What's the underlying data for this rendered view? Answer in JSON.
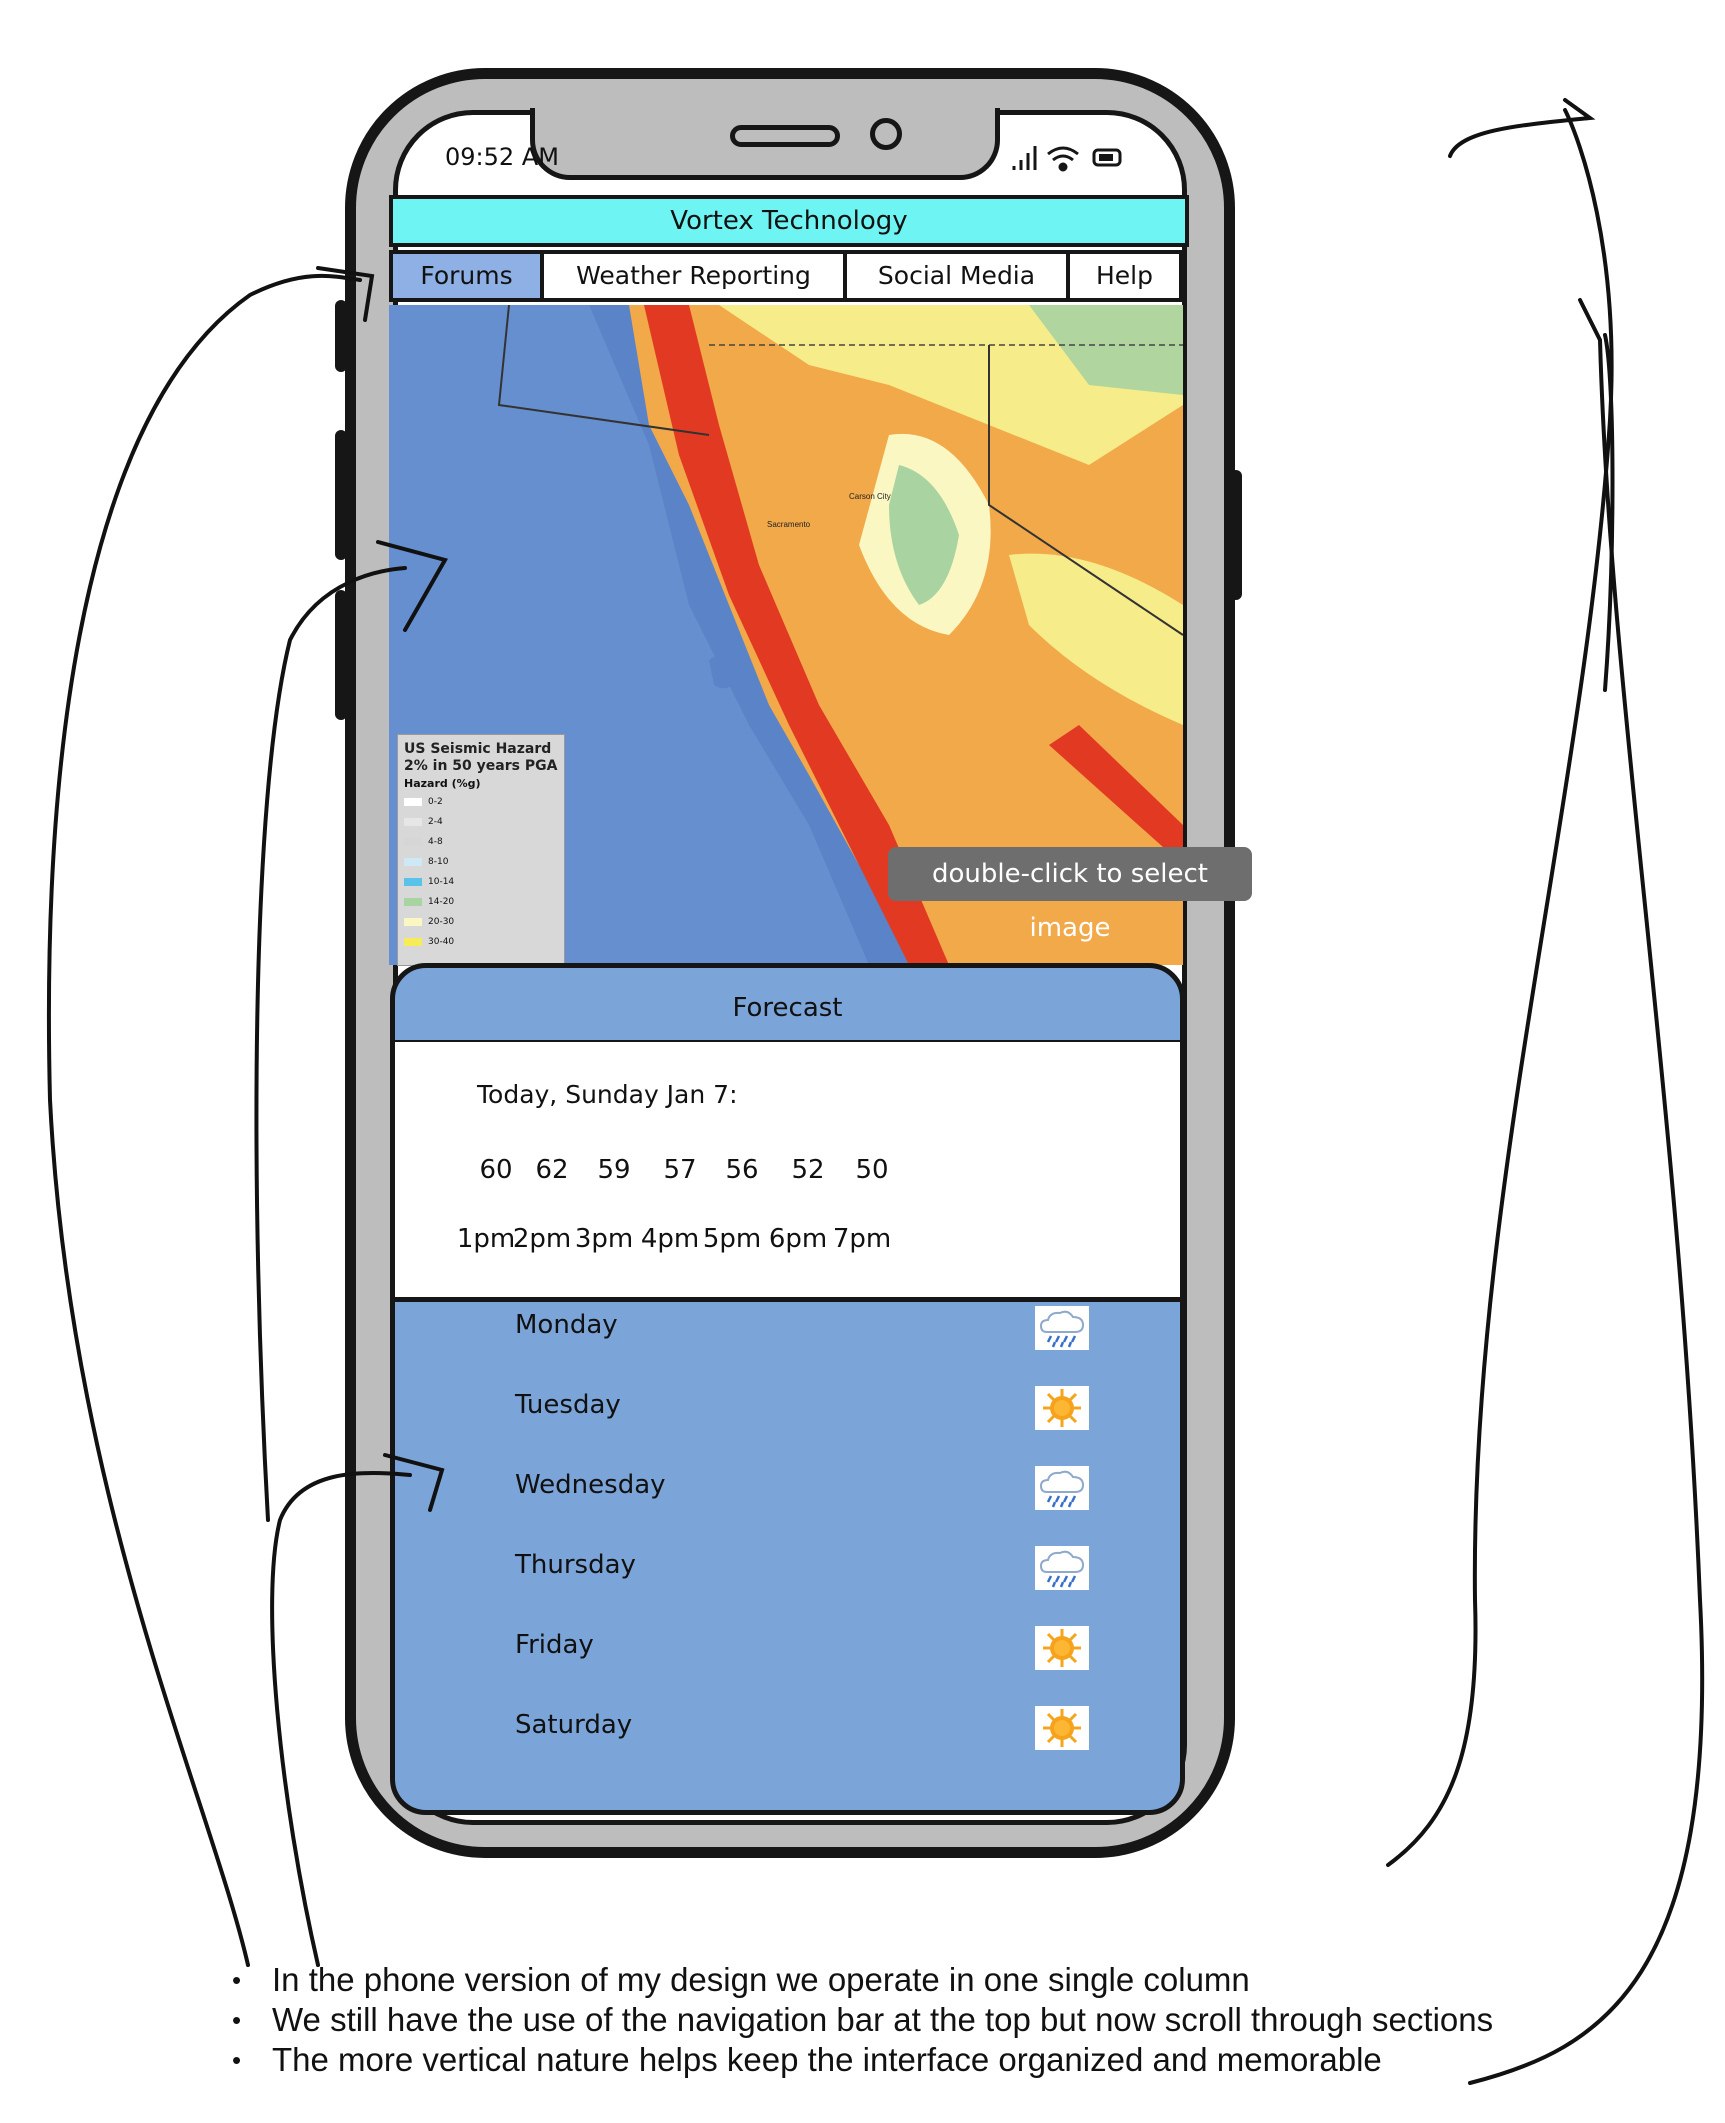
{
  "status_bar": {
    "time": "09:52 AM"
  },
  "app": {
    "title": "Vortex Technology"
  },
  "nav": {
    "items": [
      {
        "label": "Forums",
        "active": true
      },
      {
        "label": "Weather Reporting",
        "active": false
      },
      {
        "label": "Social Media",
        "active": false
      },
      {
        "label": "Help",
        "active": false
      }
    ]
  },
  "map": {
    "legend": {
      "title_line1": "US Seismic Hazard",
      "title_line2": "2% in 50 years PGA",
      "subtitle": "Hazard (%g)",
      "rows": [
        "0-2",
        "2-4",
        "4-8",
        "8-10",
        "10-14",
        "14-20",
        "20-30",
        "30-40"
      ],
      "colors": [
        "#ffffff",
        "#e6e6e6",
        "#d6d6d6",
        "#cfe8f6",
        "#5bc3ea",
        "#a9d3a0",
        "#fbf7c2",
        "#f6ec5a"
      ]
    },
    "place_labels": [
      "Carson City",
      "Sacramento"
    ],
    "tooltip": "double-click to select image"
  },
  "forecast": {
    "title": "Forecast",
    "today_label": "Today, Sunday Jan 7:",
    "temps": [
      "60",
      "62",
      "59",
      "57",
      "56",
      "52",
      "50"
    ],
    "hours": [
      "1pm",
      "2pm",
      "3pm",
      "4pm",
      "5pm",
      "6pm",
      "7pm"
    ],
    "days": [
      {
        "name": "Monday",
        "icon": "rain-cloud-icon"
      },
      {
        "name": "Tuesday",
        "icon": "sun-icon"
      },
      {
        "name": "Wednesday",
        "icon": "rain-cloud-icon"
      },
      {
        "name": "Thursday",
        "icon": "rain-cloud-icon"
      },
      {
        "name": "Friday",
        "icon": "sun-icon"
      },
      {
        "name": "Saturday",
        "icon": "sun-icon"
      }
    ]
  },
  "notes": [
    "In the phone version of my design we operate in one single column",
    "We still have the use of the navigation bar at the top but now scroll through sections",
    "The more vertical nature helps keep the interface organized and memorable"
  ],
  "colors": {
    "titlebar": "#6ff4f4",
    "nav_active": "#8fb0e4",
    "forecast_bg": "#7ba4d8",
    "phone_body": "#bdbdbd"
  }
}
